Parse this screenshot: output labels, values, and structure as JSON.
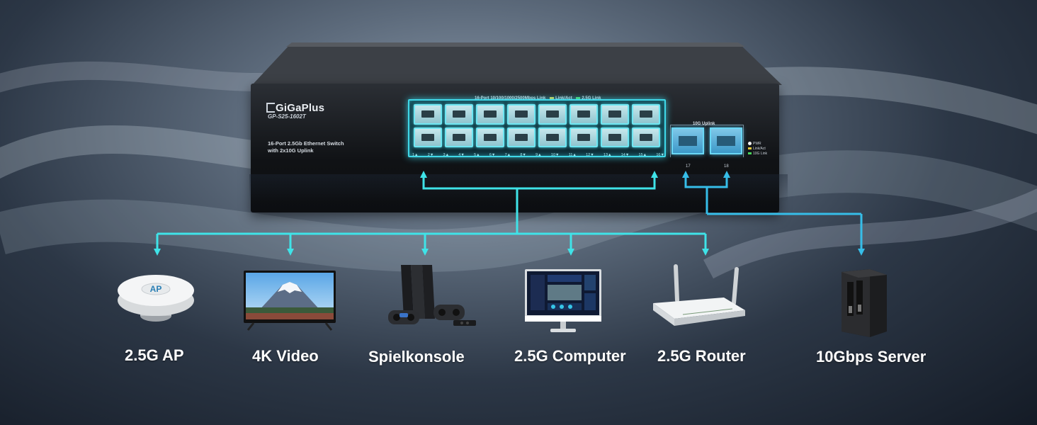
{
  "switch": {
    "brand": "GiGaPlus",
    "model": "GP-S25-1602T",
    "description_line1": "16-Port 2.5Gb Ethernet Switch",
    "description_line2": "with 2x10G Uplink",
    "ports_title": "16-Port 10/100/1000/2500Mbps Link",
    "legend_link": "Link/Act",
    "legend_25g": "2.5G Link",
    "uplink_title": "10G Uplink",
    "port_labels": [
      "1▲",
      "2▼",
      "3▲",
      "4▼",
      "5▲",
      "6▼",
      "7▲",
      "8▼",
      "9▲",
      "10▼",
      "11▲",
      "12▼",
      "13▲",
      "14▼",
      "15▲",
      "16▼"
    ],
    "uplink_ports": [
      "17",
      "18"
    ],
    "led_pwr": "PWR",
    "led_linkact": "Link/Act",
    "led_10g": "10G Link"
  },
  "colors": {
    "connector": "#3fe3e8",
    "uplink_connector": "#36bde8",
    "port_glow": "#3fd8e8"
  },
  "devices": [
    {
      "label": "2.5G AP",
      "icon": "access-point-icon",
      "ap_text": "AP"
    },
    {
      "label": "4K Video",
      "icon": "tv-icon"
    },
    {
      "label": "Spielkonsole",
      "icon": "game-console-icon"
    },
    {
      "label": "2.5G Computer",
      "icon": "computer-monitor-icon"
    },
    {
      "label": "2.5G Router",
      "icon": "router-icon"
    },
    {
      "label": "10Gbps Server",
      "icon": "server-icon"
    }
  ]
}
